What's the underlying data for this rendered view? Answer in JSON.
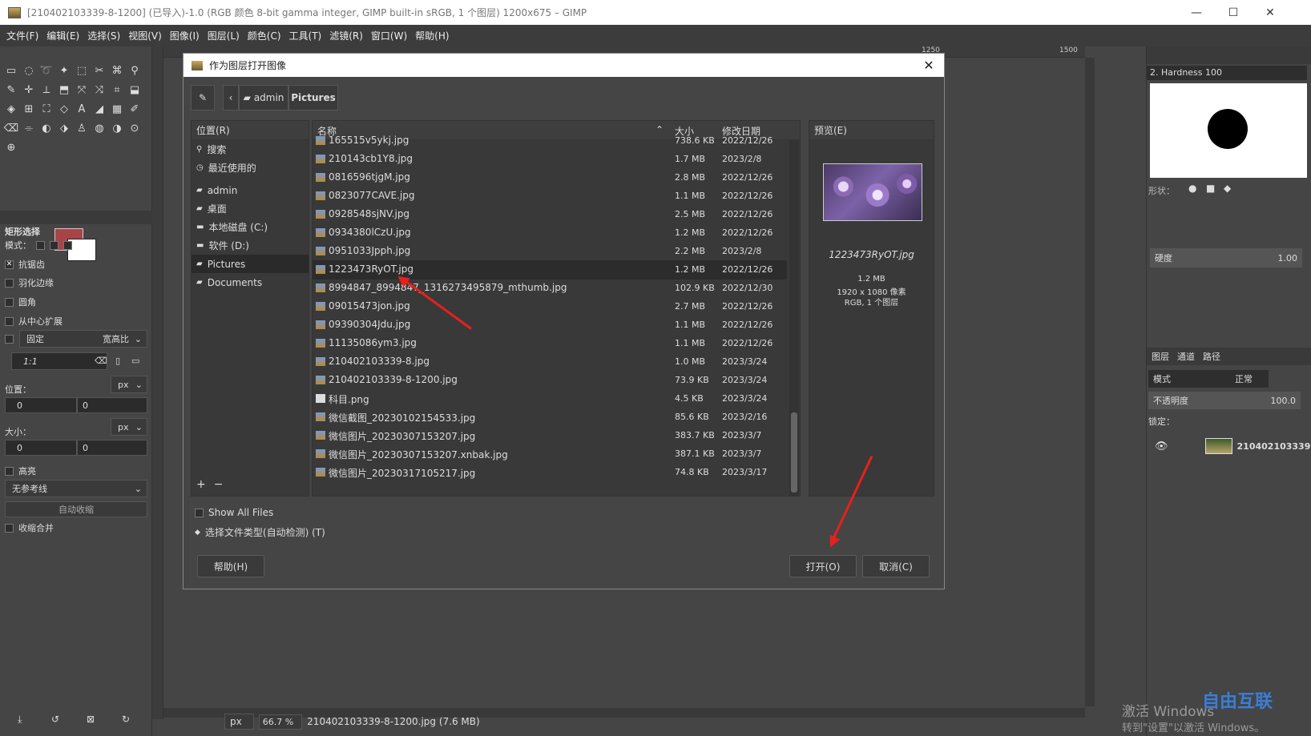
{
  "window": {
    "title": "[210402103339-8-1200] (已导入)-1.0 (RGB 颜色 8-bit gamma integer, GIMP built-in sRGB, 1 个图层) 1200x675 – GIMP",
    "controls": {
      "minimize": "—",
      "maximize": "☐",
      "close": "✕"
    }
  },
  "menubar": [
    "文件(F)",
    "编辑(E)",
    "选择(S)",
    "视图(V)",
    "图像(I)",
    "图层(L)",
    "颜色(C)",
    "工具(T)",
    "滤镜(R)",
    "窗口(W)",
    "帮助(H)"
  ],
  "tool_options": {
    "title": "矩形选择",
    "mode_label": "模式：",
    "antialias": "抗锯齿",
    "feather": "羽化边缘",
    "rounded": "圆角",
    "expand_center": "从中心扩展",
    "fixed": "固定",
    "aspect": "宽高比",
    "ratio": "1:1",
    "position_label": "位置：",
    "size_label": "大小：",
    "unit": "px",
    "pos_x": "0",
    "pos_y": "0",
    "size_w": "0",
    "size_h": "0",
    "highlight": "高亮",
    "guides": "无参考线",
    "autoshrink": "自动收缩",
    "shrink_merged": "收缩合并"
  },
  "dialog": {
    "title": "作为图层打开图像",
    "path": [
      "admin",
      "Pictures"
    ],
    "places_header": "位置(R)",
    "places": [
      {
        "label": "搜索",
        "icon": "search-icon"
      },
      {
        "label": "最近使用的",
        "icon": "recent-icon"
      },
      {
        "label": "admin",
        "icon": "folder-icon"
      },
      {
        "label": "桌面",
        "icon": "folder-icon"
      },
      {
        "label": "本地磁盘 (C:)",
        "icon": "drive-icon"
      },
      {
        "label": "软件 (D:)",
        "icon": "drive-icon"
      },
      {
        "label": "Pictures",
        "icon": "folder-icon"
      },
      {
        "label": "Documents",
        "icon": "folder-icon"
      }
    ],
    "columns": {
      "name": "名称",
      "size": "大小",
      "date": "修改日期"
    },
    "files": [
      {
        "name": "165515v5ykj.jpg",
        "size": "738.6 KB",
        "date": "2022/12/26"
      },
      {
        "name": "210143cb1Y8.jpg",
        "size": "1.7 MB",
        "date": "2023/2/8"
      },
      {
        "name": "0816596tjgM.jpg",
        "size": "2.8 MB",
        "date": "2022/12/26"
      },
      {
        "name": "0823077CAVE.jpg",
        "size": "1.1 MB",
        "date": "2022/12/26"
      },
      {
        "name": "0928548sjNV.jpg",
        "size": "2.5 MB",
        "date": "2022/12/26"
      },
      {
        "name": "0934380lCzU.jpg",
        "size": "1.2 MB",
        "date": "2022/12/26"
      },
      {
        "name": "0951033Jpph.jpg",
        "size": "2.2 MB",
        "date": "2023/2/8"
      },
      {
        "name": "1223473RyOT.jpg",
        "size": "1.2 MB",
        "date": "2022/12/26"
      },
      {
        "name": "8994847_8994847_1316273495879_mthumb.jpg",
        "size": "102.9 KB",
        "date": "2022/12/30"
      },
      {
        "name": "09015473jon.jpg",
        "size": "2.7 MB",
        "date": "2022/12/26"
      },
      {
        "name": "09390304Jdu.jpg",
        "size": "1.1 MB",
        "date": "2022/12/26"
      },
      {
        "name": "11135086ym3.jpg",
        "size": "1.1 MB",
        "date": "2022/12/26"
      },
      {
        "name": "210402103339-8.jpg",
        "size": "1.0 MB",
        "date": "2023/3/24"
      },
      {
        "name": "210402103339-8-1200.jpg",
        "size": "73.9 KB",
        "date": "2023/3/24"
      },
      {
        "name": "科目.png",
        "size": "4.5 KB",
        "date": "2023/3/24"
      },
      {
        "name": "微信截图_20230102154533.jpg",
        "size": "85.6 KB",
        "date": "2023/2/16"
      },
      {
        "name": "微信图片_20230307153207.jpg",
        "size": "383.7 KB",
        "date": "2023/3/7"
      },
      {
        "name": "微信图片_20230307153207.xnbak.jpg",
        "size": "387.1 KB",
        "date": "2023/3/7"
      },
      {
        "name": "微信图片_20230317105217.jpg",
        "size": "74.8 KB",
        "date": "2023/3/17"
      }
    ],
    "selected_index": 7,
    "preview_header": "预览(E)",
    "preview": {
      "name": "1223473RyOT.jpg",
      "size": "1.2 MB",
      "dims": "1920 x 1080 像素",
      "info": "RGB, 1 个图层"
    },
    "show_all": "Show All Files",
    "file_type": "选择文件类型(自动检测) (T)",
    "help": "帮助(H)",
    "open": "打开(O)",
    "cancel": "取消(C)"
  },
  "brushes": {
    "name": "2. Hardness 100",
    "shape_label": "形状：",
    "hardness_label": "硬度",
    "hardness": "1.00"
  },
  "layers": {
    "tabs": [
      "图层",
      "通道",
      "路径"
    ],
    "mode_label": "模式",
    "mode": "正常",
    "opacity_label": "不透明度",
    "opacity": "100.0",
    "lock_label": "锁定：",
    "layer_name": "210402103339"
  },
  "ruler": {
    "marks": [
      "1250",
      "1500"
    ]
  },
  "status": {
    "unit": "px",
    "zoom": "66.7 %",
    "file": "210402103339-8-1200.jpg (7.6 MB)"
  },
  "watermark": {
    "line1": "激活 Windows",
    "line2": "转到\"设置\"以激活 Windows。",
    "brand": "自由互联"
  },
  "colors": {
    "accent_arrow": "#e8201c",
    "fg": "#a84448",
    "bg": "#ffffff"
  }
}
